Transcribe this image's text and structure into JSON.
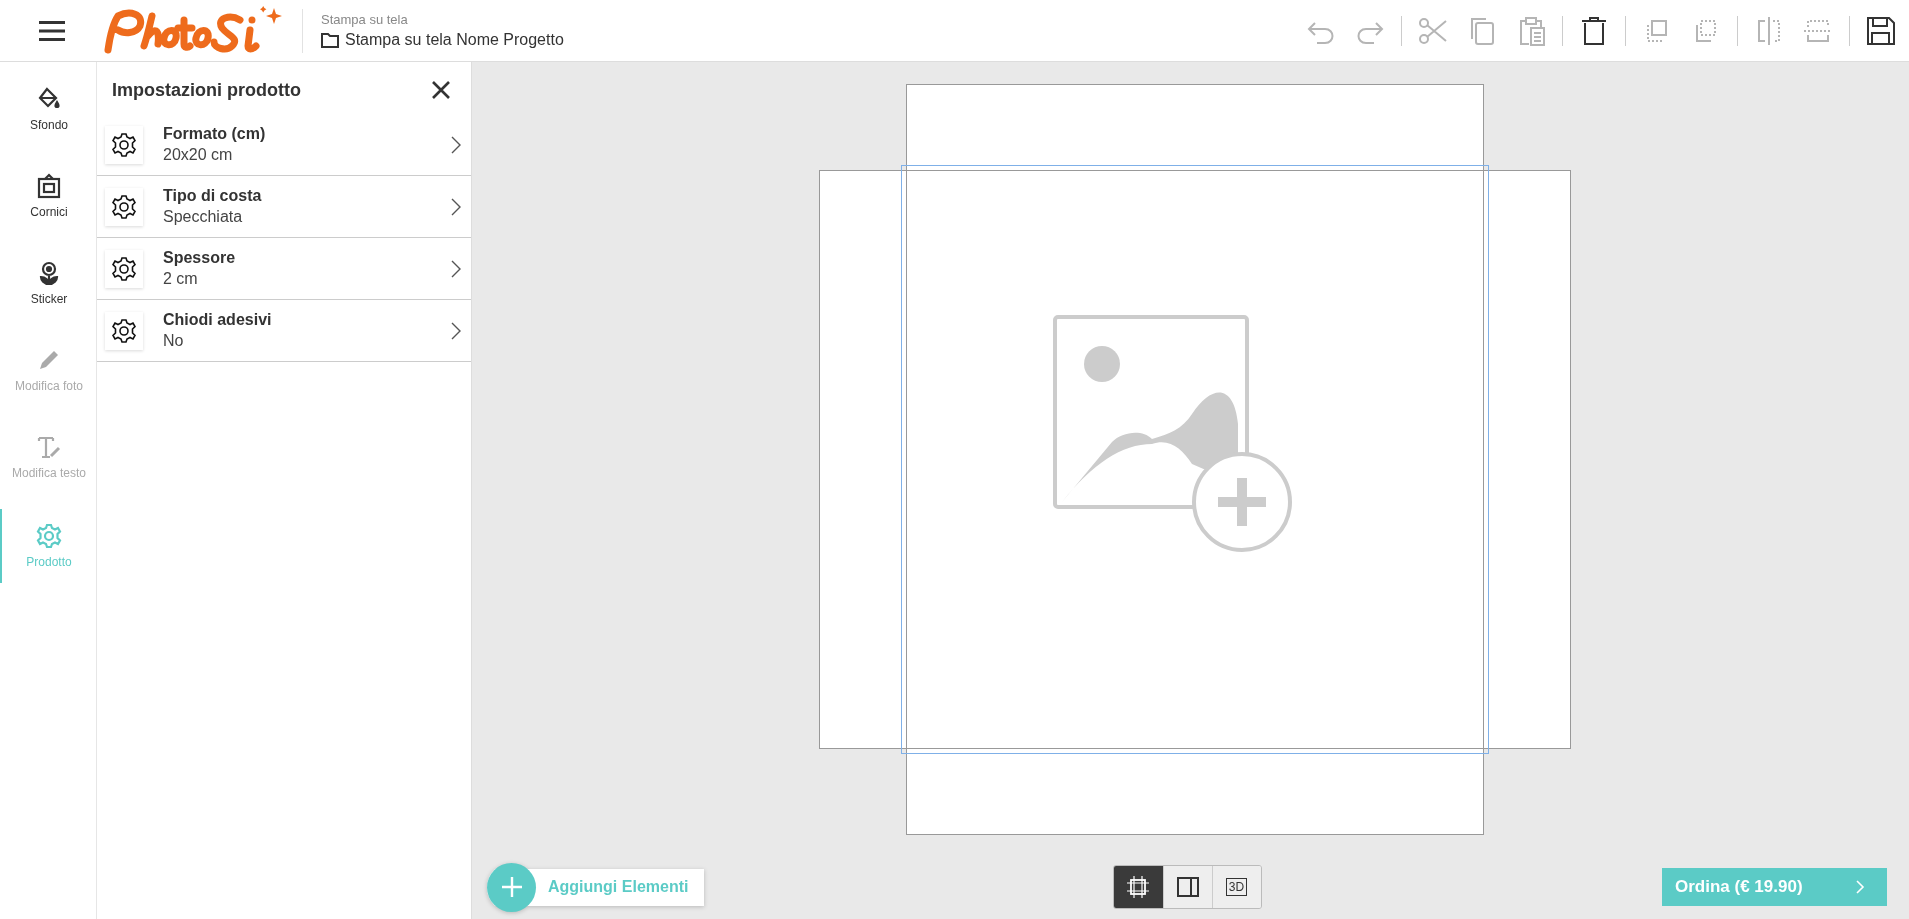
{
  "header": {
    "breadcrumb": "Stampa su tela",
    "project_name": "Stampa su tela Nome Progetto"
  },
  "toolbar": [
    {
      "kind": "undo",
      "disabled": true
    },
    {
      "kind": "redo",
      "disabled": true
    },
    {
      "kind": "separator"
    },
    {
      "kind": "cut",
      "disabled": true
    },
    {
      "kind": "copy",
      "disabled": true
    },
    {
      "kind": "paste",
      "disabled": true
    },
    {
      "kind": "separator"
    },
    {
      "kind": "delete",
      "disabled": false
    },
    {
      "kind": "separator"
    },
    {
      "kind": "forward",
      "disabled": true
    },
    {
      "kind": "backward",
      "disabled": true
    },
    {
      "kind": "separator"
    },
    {
      "kind": "flip-h",
      "disabled": true
    },
    {
      "kind": "flip-v",
      "disabled": true
    },
    {
      "kind": "separator"
    },
    {
      "kind": "save",
      "disabled": false
    }
  ],
  "sidebar": {
    "items": [
      {
        "kind": "background",
        "label": "Sfondo",
        "selected": false,
        "disabled": false
      },
      {
        "kind": "frames",
        "label": "Cornici",
        "selected": false,
        "disabled": false
      },
      {
        "kind": "sticker",
        "label": "Sticker",
        "selected": false,
        "disabled": false
      },
      {
        "kind": "photo",
        "label": "Modifica foto",
        "selected": false,
        "disabled": true
      },
      {
        "kind": "text",
        "label": "Modifica testo",
        "selected": false,
        "disabled": true
      },
      {
        "kind": "product",
        "label": "Prodotto",
        "selected": true,
        "disabled": false
      }
    ]
  },
  "panel": {
    "title": "Impostazioni prodotto",
    "settings": [
      {
        "label": "Formato (cm)",
        "value": "20x20 cm"
      },
      {
        "label": "Tipo di costa",
        "value": "Specchiata"
      },
      {
        "label": "Spessore",
        "value": "2 cm"
      },
      {
        "label": "Chiodi adesivi",
        "value": "No"
      }
    ]
  },
  "add_button": {
    "label": "Aggiungi Elementi"
  },
  "view_modes": [
    {
      "kind": "flat",
      "selected": true
    },
    {
      "kind": "side",
      "selected": false
    },
    {
      "kind": "threed",
      "label": "3D",
      "selected": false
    }
  ],
  "order_button": {
    "label": "Ordina (€ 19.90)"
  }
}
